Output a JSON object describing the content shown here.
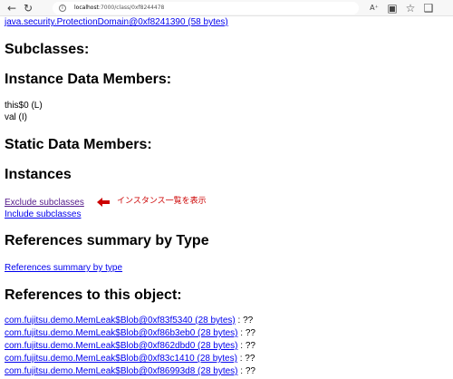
{
  "browser": {
    "url_host": "localhost",
    "url_path": ":7000/class/0xf8244478",
    "icons": [
      "back-icon",
      "reload-icon",
      "info-icon",
      "read-aloud-icon",
      "tab-icon",
      "favorite-icon",
      "collections-icon"
    ]
  },
  "top_link": "java.security.ProtectionDomain@0xf8241390 (58 bytes)",
  "sections": {
    "subclasses": "Subclasses:",
    "instance_members": "Instance Data Members:",
    "static_members": "Static Data Members:",
    "instances": "Instances",
    "references_summary": "References summary by Type",
    "references_to": "References to this object:"
  },
  "instance_members": [
    "this$0 (L)",
    "val (I)"
  ],
  "instance_links": {
    "exclude": "Exclude subclasses",
    "include": "Include subclasses"
  },
  "annotation": {
    "text": "インスタンス一覧を表示",
    "color": "#cc0000"
  },
  "references_summary_link": "References summary by type",
  "references": [
    {
      "link": "com.fujitsu.demo.MemLeak$Blob@0xf83f5340 (28 bytes)",
      "suffix": " : ??"
    },
    {
      "link": "com.fujitsu.demo.MemLeak$Blob@0xf86b3eb0 (28 bytes)",
      "suffix": " : ??"
    },
    {
      "link": "com.fujitsu.demo.MemLeak$Blob@0xf862dbd0 (28 bytes)",
      "suffix": " : ??"
    },
    {
      "link": "com.fujitsu.demo.MemLeak$Blob@0xf83c1410 (28 bytes)",
      "suffix": " : ??"
    },
    {
      "link": "com.fujitsu.demo.MemLeak$Blob@0xf86993d8 (28 bytes)",
      "suffix": " : ??"
    }
  ]
}
